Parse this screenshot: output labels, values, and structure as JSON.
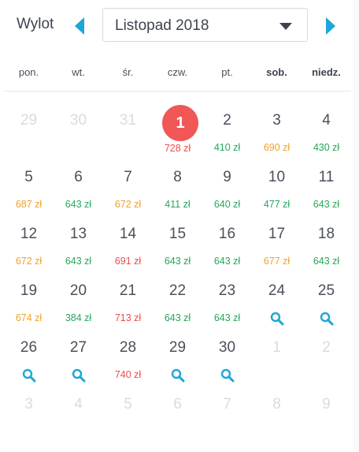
{
  "header": {
    "label": "Wylot",
    "month_value": "Listopad 2018",
    "prev_icon": "chevron-left-icon",
    "next_icon": "chevron-right-icon",
    "caret_icon": "caret-down-icon"
  },
  "weekdays": [
    "pon.",
    "wt.",
    "śr.",
    "czw.",
    "pt.",
    "sob.",
    "niedz."
  ],
  "colors": {
    "accent": "#1ca7d6",
    "green": "#26a65b",
    "orange": "#f2a02b",
    "red": "#ef4b4b",
    "today": "#f25757",
    "muted": "#d9dbe0"
  },
  "weeks": [
    [
      {
        "day": "29",
        "muted": true
      },
      {
        "day": "30",
        "muted": true
      },
      {
        "day": "31",
        "muted": true
      },
      {
        "day": "1",
        "today": true,
        "price": "728 zł",
        "tone": "red"
      },
      {
        "day": "2",
        "price": "410 zł",
        "tone": "green"
      },
      {
        "day": "3",
        "price": "690 zł",
        "tone": "orange"
      },
      {
        "day": "4",
        "price": "430 zł",
        "tone": "green"
      }
    ],
    [
      {
        "day": "5",
        "price": "687 zł",
        "tone": "orange"
      },
      {
        "day": "6",
        "price": "643 zł",
        "tone": "green"
      },
      {
        "day": "7",
        "price": "672 zł",
        "tone": "orange"
      },
      {
        "day": "8",
        "price": "411 zł",
        "tone": "green"
      },
      {
        "day": "9",
        "price": "640 zł",
        "tone": "green"
      },
      {
        "day": "10",
        "price": "477 zł",
        "tone": "green"
      },
      {
        "day": "11",
        "price": "643 zł",
        "tone": "green"
      }
    ],
    [
      {
        "day": "12",
        "price": "672 zł",
        "tone": "orange"
      },
      {
        "day": "13",
        "price": "643 zł",
        "tone": "green"
      },
      {
        "day": "14",
        "price": "691 zł",
        "tone": "red"
      },
      {
        "day": "15",
        "price": "643 zł",
        "tone": "green"
      },
      {
        "day": "16",
        "price": "643 zł",
        "tone": "green"
      },
      {
        "day": "17",
        "price": "677 zł",
        "tone": "orange"
      },
      {
        "day": "18",
        "price": "643 zł",
        "tone": "green"
      }
    ],
    [
      {
        "day": "19",
        "price": "674 zł",
        "tone": "orange"
      },
      {
        "day": "20",
        "price": "384 zł",
        "tone": "green"
      },
      {
        "day": "21",
        "price": "713 zł",
        "tone": "red"
      },
      {
        "day": "22",
        "price": "643 zł",
        "tone": "green"
      },
      {
        "day": "23",
        "price": "643 zł",
        "tone": "green"
      },
      {
        "day": "24",
        "search": true
      },
      {
        "day": "25",
        "search": true
      }
    ],
    [
      {
        "day": "26",
        "search": true
      },
      {
        "day": "27",
        "search": true
      },
      {
        "day": "28",
        "price": "740 zł",
        "tone": "red"
      },
      {
        "day": "29",
        "search": true
      },
      {
        "day": "30",
        "search": true
      },
      {
        "day": "1",
        "muted": true
      },
      {
        "day": "2",
        "muted": true
      }
    ],
    [
      {
        "day": "3",
        "muted": true
      },
      {
        "day": "4",
        "muted": true
      },
      {
        "day": "5",
        "muted": true
      },
      {
        "day": "6",
        "muted": true
      },
      {
        "day": "7",
        "muted": true
      },
      {
        "day": "8",
        "muted": true
      },
      {
        "day": "9",
        "muted": true
      }
    ]
  ]
}
